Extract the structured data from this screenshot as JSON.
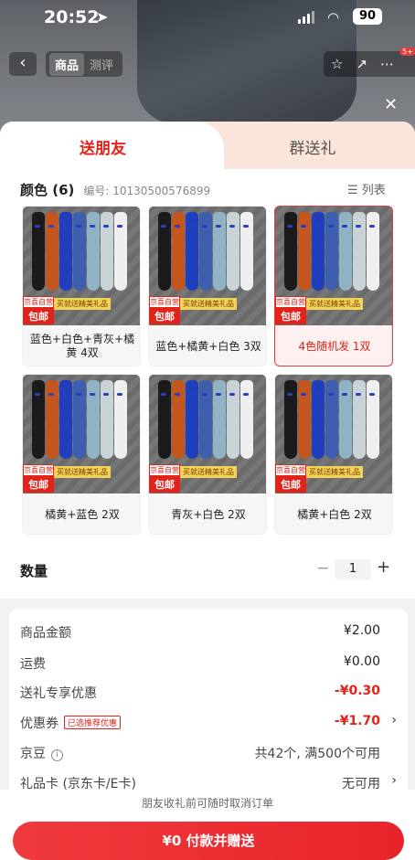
{
  "status": {
    "time": "20:52",
    "battery": "90"
  },
  "nav": {
    "tabs": [
      "商品",
      "测评"
    ],
    "badge": "5+"
  },
  "gift_tabs": {
    "send_friend": "送朋友",
    "group_gift": "群送礼"
  },
  "spec": {
    "title": "颜色 (6)",
    "sku": "编号: 10130500576899",
    "view_toggle": "列表"
  },
  "promo": {
    "badge_top": "京喜自营",
    "badge_bottom": "包邮",
    "tagline": "买就送精美礼品"
  },
  "options": [
    {
      "label": "蓝色+白色+青灰+橘黄 4双",
      "selected": false
    },
    {
      "label": "蓝色+橘黄+白色 3双",
      "selected": false
    },
    {
      "label": "4色随机发 1双",
      "selected": true
    },
    {
      "label": "橘黄+蓝色 2双",
      "selected": false
    },
    {
      "label": "青灰+白色 2双",
      "selected": false
    },
    {
      "label": "橘黄+白色 2双",
      "selected": false
    }
  ],
  "quantity": {
    "label": "数量",
    "value": "1",
    "minus": "−",
    "plus": "+"
  },
  "prices": {
    "goods_label": "商品金额",
    "goods_value": "¥2.00",
    "shipping_label": "运费",
    "shipping_value": "¥0.00",
    "gift_discount_label": "送礼专享优惠",
    "gift_discount_value": "-¥0.30",
    "coupon_label": "优惠券",
    "coupon_badge": "已选推荐优惠",
    "coupon_value": "-¥1.70",
    "jingdou_label": "京豆",
    "jingdou_value": "共42个, 满500个可用",
    "giftcard_label": "礼品卡 (京东卡/E卡)",
    "giftcard_value": "无可用"
  },
  "footer": {
    "note": "朋友收礼前可随时取消订单",
    "pay_button": "¥0 付款并赠送"
  },
  "colors": {
    "accent": "#e2231a",
    "tab_bg": "#fbe4d9"
  }
}
